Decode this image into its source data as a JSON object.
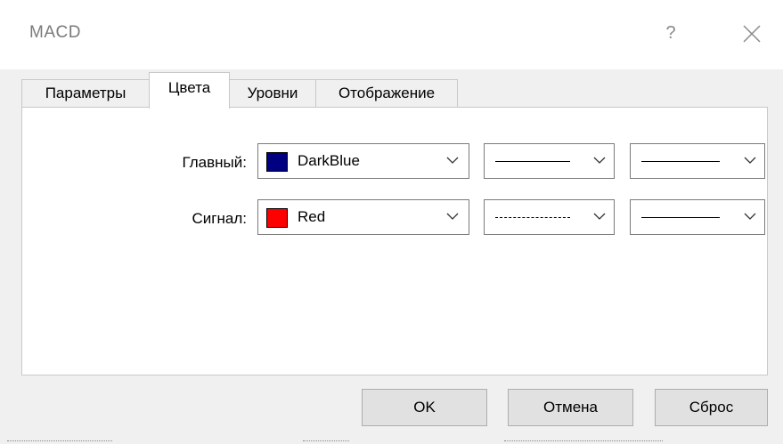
{
  "window": {
    "title": "MACD",
    "help_label": "?"
  },
  "tabs": [
    {
      "label": "Параметры",
      "active": false
    },
    {
      "label": "Цвета",
      "active": true
    },
    {
      "label": "Уровни",
      "active": false
    },
    {
      "label": "Отображение",
      "active": false
    }
  ],
  "rows": [
    {
      "label": "Главный:",
      "color_name": "DarkBlue",
      "color_hex": "#000080",
      "line_style": "solid",
      "line_width": "thin"
    },
    {
      "label": "Сигнал:",
      "color_name": "Red",
      "color_hex": "#ff0000",
      "line_style": "dashed",
      "line_width": "thin"
    }
  ],
  "buttons": {
    "ok": "OK",
    "cancel": "Отмена",
    "reset": "Сброс"
  },
  "icons": {
    "close": "close-icon",
    "dropdown": "chevron-down-icon"
  }
}
